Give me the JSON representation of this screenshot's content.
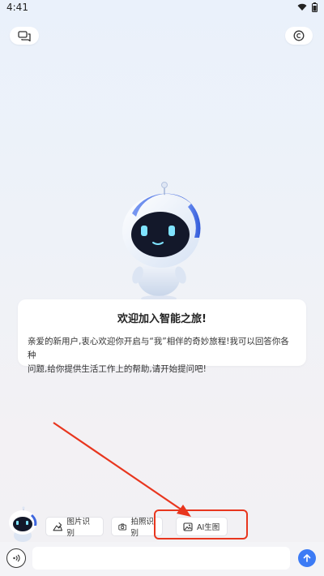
{
  "status_bar": {
    "time": "4:41"
  },
  "icons": {
    "chat_history": "chat-bubbles-icon",
    "settings": "circle-c-icon",
    "voice": "voice-wave-icon",
    "send": "arrow-up-icon"
  },
  "welcome": {
    "title": "欢迎加入智能之旅!",
    "line1": "亲爱的新用户,衷心欢迎你开启与“我”相伴的奇妙旅程!我可以回答你各种",
    "line2": "问题,给你提供生活工作上的帮助,请开始提问吧!"
  },
  "quick_actions": [
    {
      "label": "图片识别",
      "icon": "image-edit-icon"
    },
    {
      "label": "拍照识别",
      "icon": "camera-icon"
    },
    {
      "label": "AI生图",
      "icon": "image-icon"
    }
  ],
  "input": {
    "value": "",
    "placeholder": ""
  },
  "colors": {
    "accent": "#3c7bf5",
    "annotation": "#e8361e"
  }
}
